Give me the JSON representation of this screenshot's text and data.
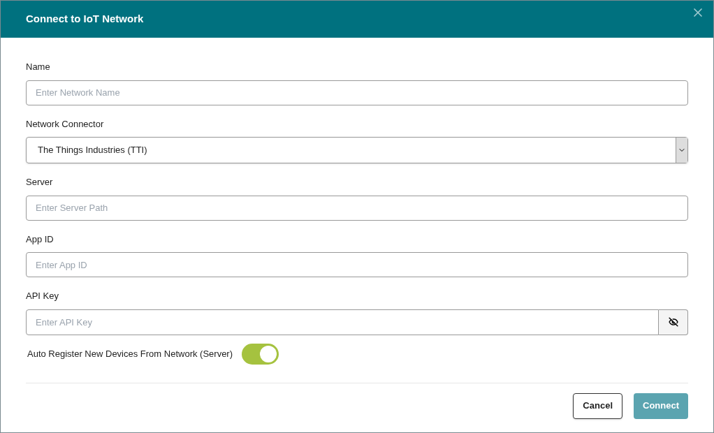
{
  "dialog": {
    "title": "Connect to IoT Network"
  },
  "fields": [
    {
      "kind": "text",
      "label": "Name",
      "placeholder": "Enter Network Name"
    },
    {
      "kind": "select",
      "label": "Network Connector",
      "value": "The Things Industries (TTI)"
    },
    {
      "kind": "text",
      "label": "Server",
      "placeholder": "Enter Server Path"
    },
    {
      "kind": "text",
      "label": "App ID",
      "placeholder": "Enter App ID"
    },
    {
      "kind": "password",
      "label": "API Key",
      "placeholder": "Enter API Key"
    }
  ],
  "toggle": {
    "label": "Auto Register New Devices From Network (Server)",
    "on": true
  },
  "buttons": [
    {
      "kind": "secondary",
      "label": "Cancel",
      "disabled": false
    },
    {
      "kind": "primary",
      "label": "Connect",
      "disabled": true
    }
  ]
}
